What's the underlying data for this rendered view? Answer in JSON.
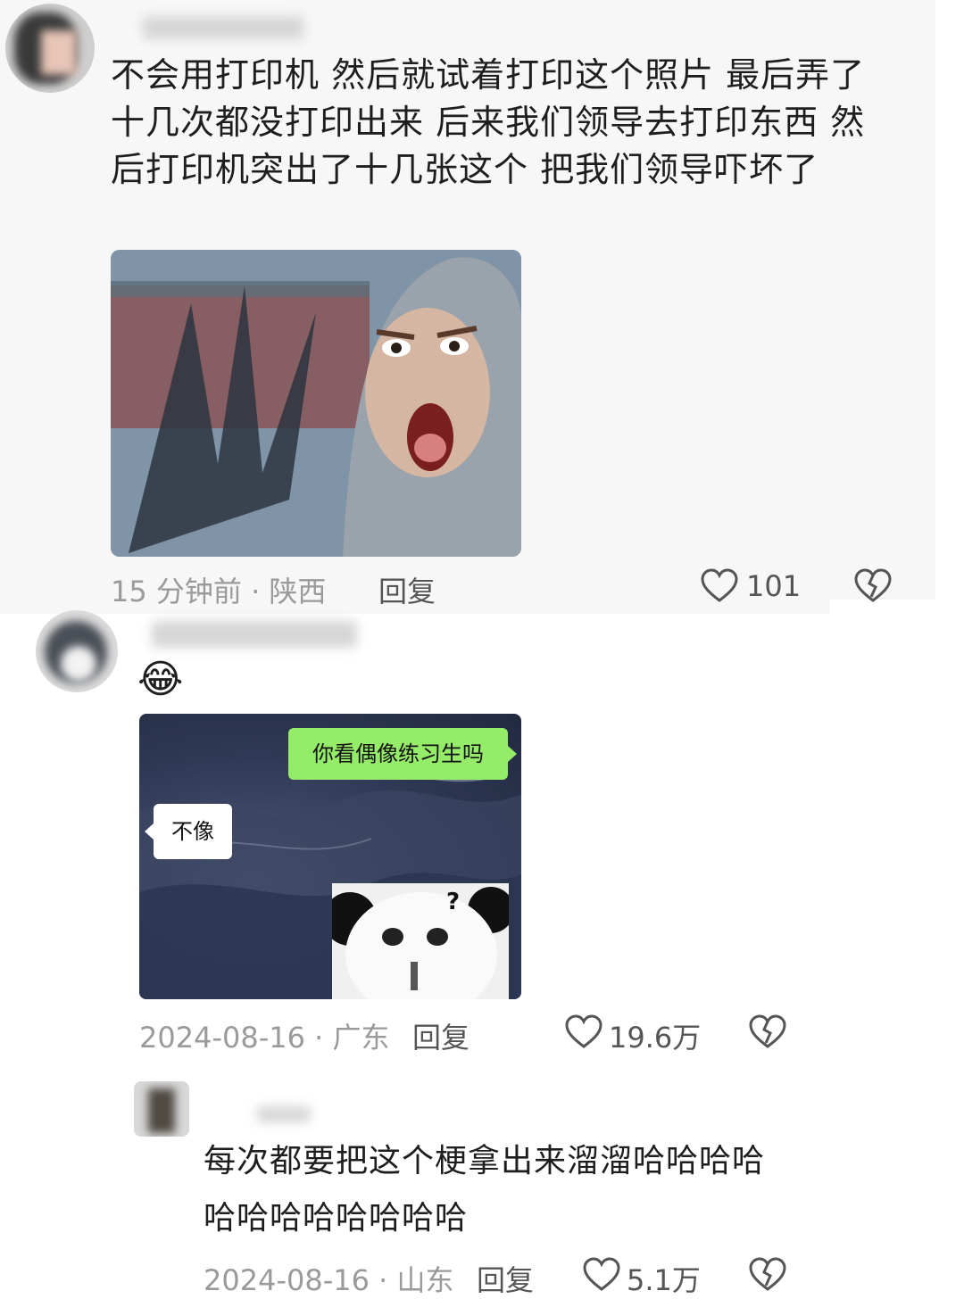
{
  "comments": [
    {
      "text": "不会用打印机  然后就试着打印这个照片   最后弄了十几次都没打印出来   后来我们领导去打印东西   然后打印机突出了十几张这个   把我们领导吓坏了",
      "time_location": "15 分钟前 · 陕西",
      "reply_label": "回复",
      "likes": "101",
      "icons": [
        "heart-outline-icon",
        "broken-heart-icon"
      ]
    },
    {
      "emoji": "😂",
      "image": {
        "bubble_green": "你看偶像练习生吗",
        "bubble_white": "不像",
        "panda_mark": "?"
      },
      "time_location": "2024-08-16 · 广东",
      "reply_label": "回复",
      "likes": "19.6万",
      "icons": [
        "heart-outline-icon",
        "broken-heart-icon"
      ]
    },
    {
      "text": "每次都要把这个梗拿出来溜溜哈哈哈哈哈哈哈哈哈哈哈哈",
      "time_location": "2024-08-16 · 山东",
      "reply_label": "回复",
      "likes": "5.1万",
      "icons": [
        "heart-outline-icon",
        "broken-heart-icon"
      ]
    }
  ]
}
